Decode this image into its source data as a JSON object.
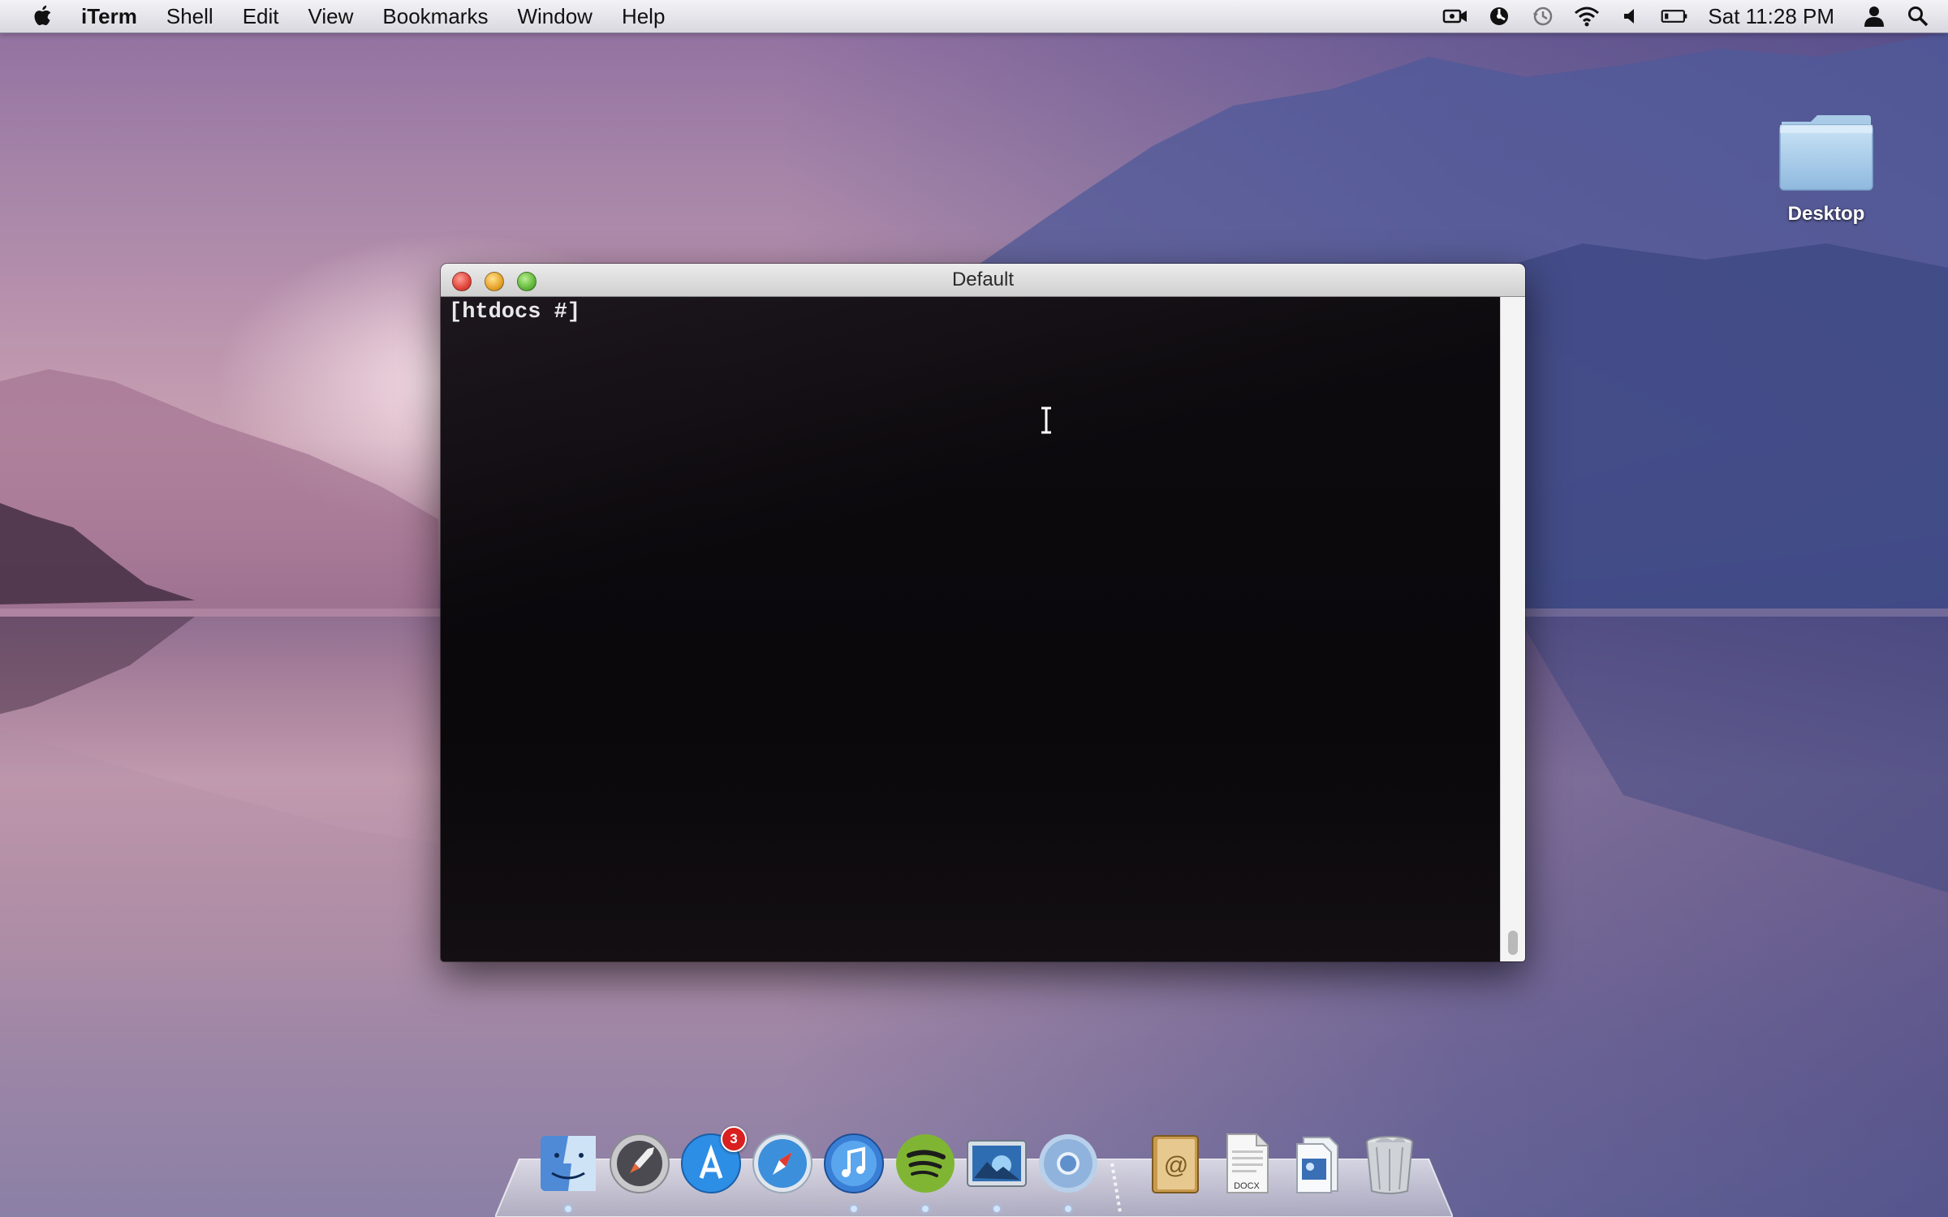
{
  "menubar": {
    "app_name": "iTerm",
    "items": [
      "Shell",
      "Edit",
      "View",
      "Bookmarks",
      "Window",
      "Help"
    ],
    "clock": "Sat 11:28 PM"
  },
  "desktop": {
    "icon_label": "Desktop"
  },
  "window": {
    "title": "Default",
    "prompt": "[htdocs #]"
  },
  "dock": {
    "items": [
      {
        "name": "finder"
      },
      {
        "name": "launchpad"
      },
      {
        "name": "app-store",
        "badge": "3"
      },
      {
        "name": "safari"
      },
      {
        "name": "itunes"
      },
      {
        "name": "spotify"
      },
      {
        "name": "preview"
      },
      {
        "name": "chrome"
      },
      {
        "name": "address-book"
      },
      {
        "name": "document",
        "label": "DOCX"
      },
      {
        "name": "downloads-stack"
      },
      {
        "name": "trash"
      }
    ]
  }
}
